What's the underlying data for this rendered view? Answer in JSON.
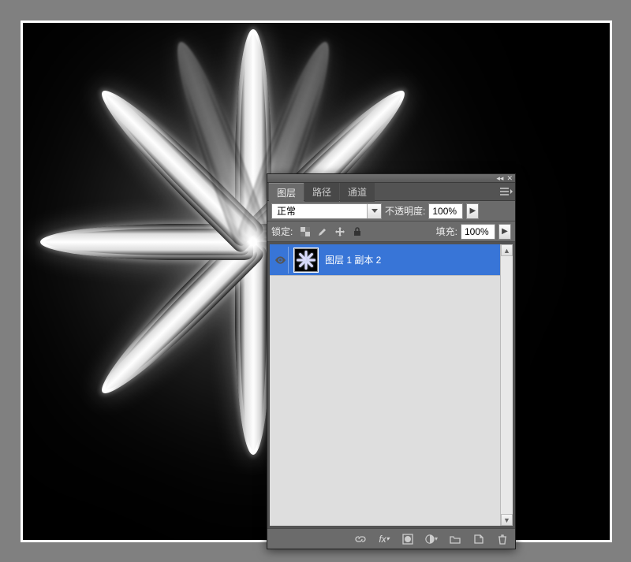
{
  "panel": {
    "tabs": [
      "图层",
      "路径",
      "通道"
    ],
    "active_tab": "图层",
    "blend_mode": "正常",
    "opacity_label": "不透明度:",
    "opacity_value": "100%",
    "lock_label": "锁定:",
    "fill_label": "填充:",
    "fill_value": "100%",
    "lock_icons": [
      "transparent-lock-icon",
      "brush-lock-icon",
      "move-lock-icon",
      "lock-all-icon"
    ]
  },
  "layers": [
    {
      "name": "图层 1 副本 2",
      "visible": true,
      "selected": true
    }
  ],
  "footer_icons": [
    "link-layers-icon",
    "fx-icon",
    "layer-mask-icon",
    "adjustment-icon",
    "group-icon",
    "new-layer-icon",
    "trash-icon"
  ]
}
